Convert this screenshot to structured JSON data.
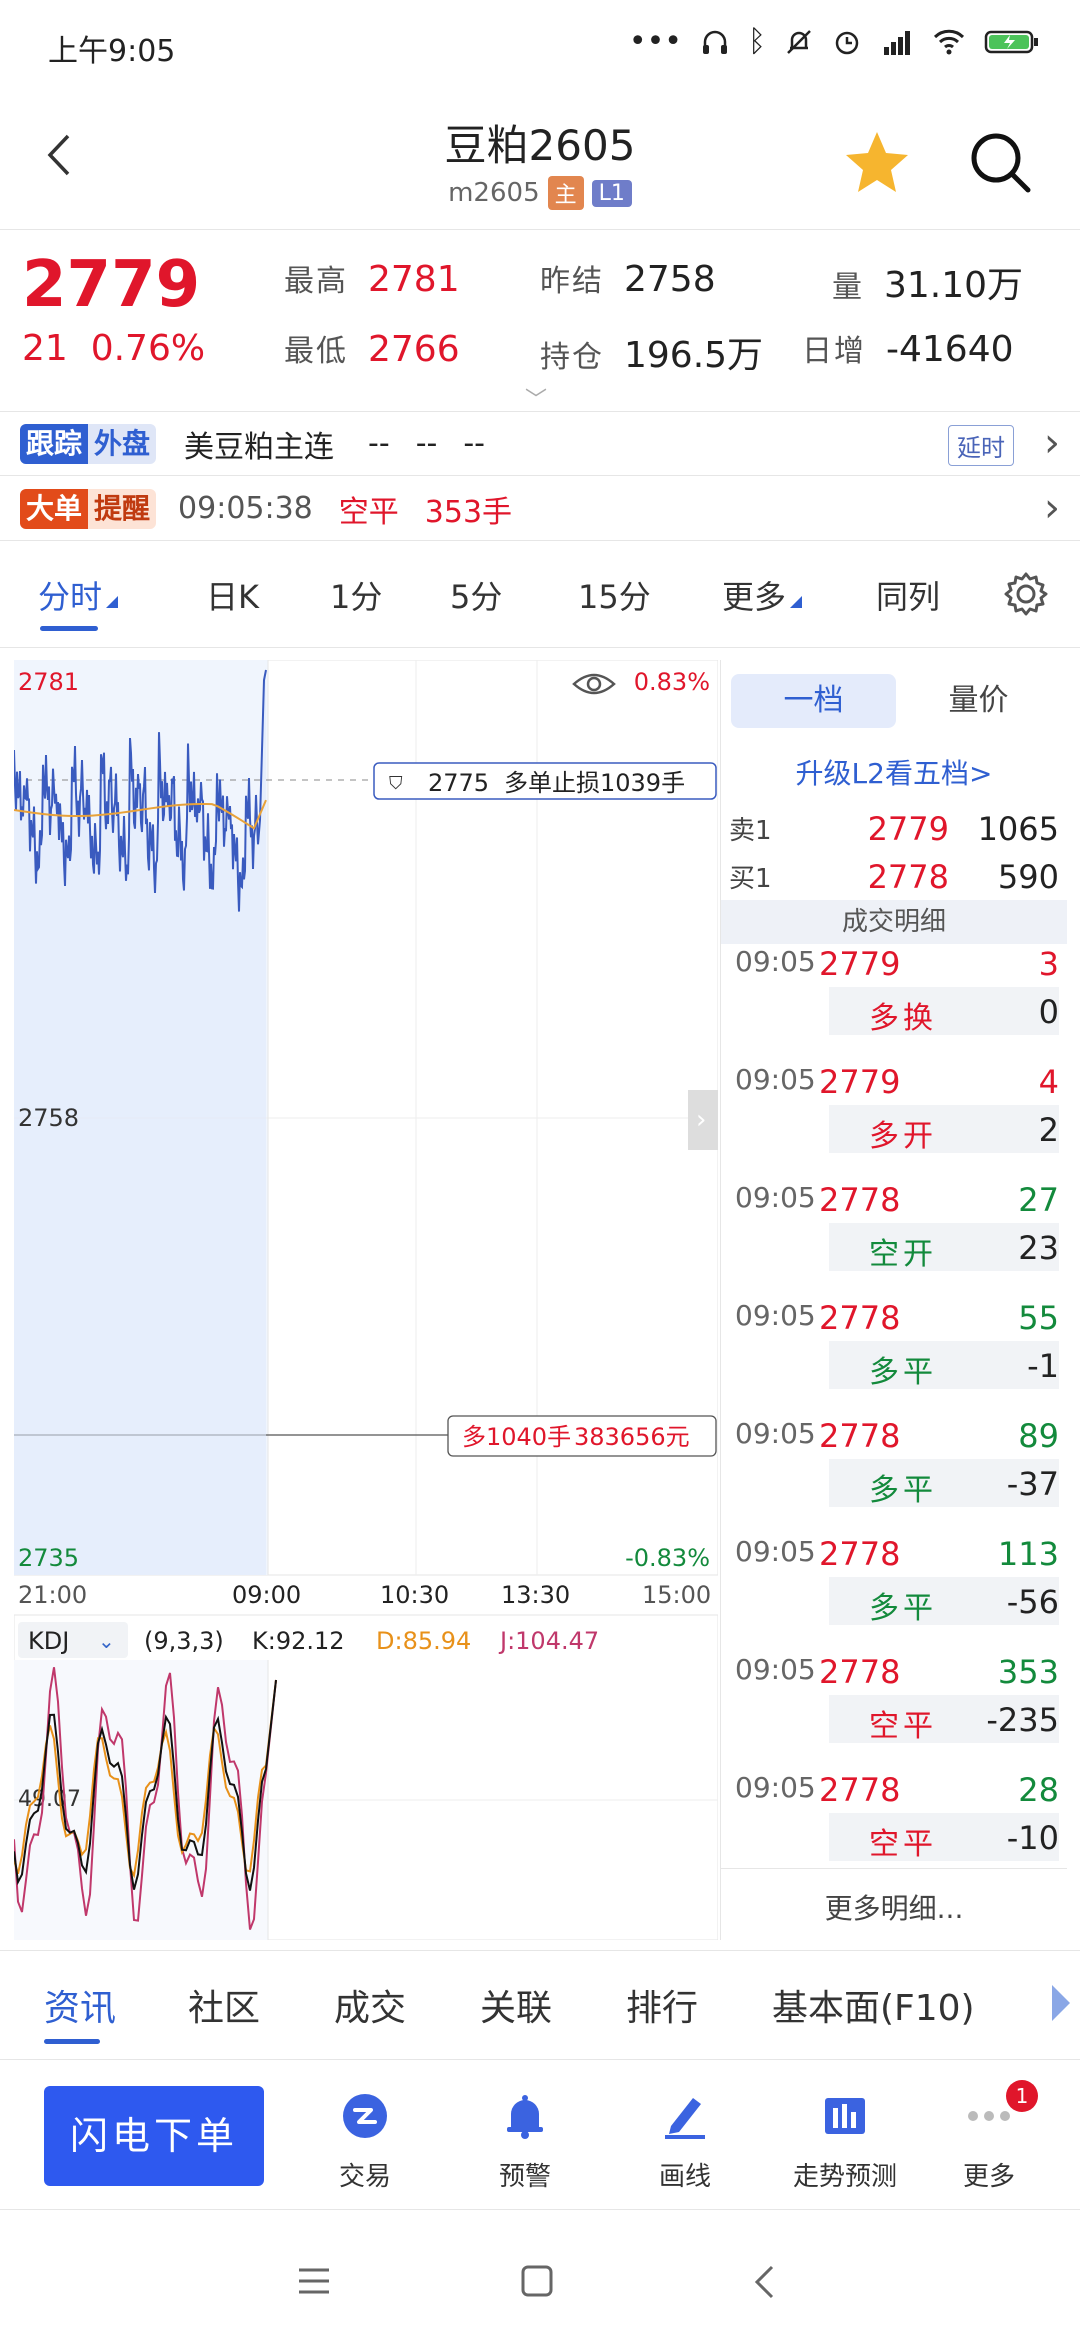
{
  "status_bar": {
    "time": "上午9:05",
    "icons": [
      "more-icon",
      "headphones-icon",
      "bluetooth-icon",
      "mute-icon",
      "alarm-icon",
      "signal-icon",
      "wifi-icon",
      "battery-icon"
    ]
  },
  "header": {
    "title": "豆粕2605",
    "code": "m2605",
    "tag_main": "主",
    "tag_level": "L1"
  },
  "quote": {
    "price": "2779",
    "change": "21",
    "change_pct": "0.76%",
    "high_label": "最高",
    "high": "2781",
    "low_label": "最低",
    "low": "2766",
    "prev_settle_label": "昨结",
    "prev_settle": "2758",
    "open_interest_label": "持仓",
    "open_interest": "196.5万",
    "volume_label": "量",
    "volume": "31.10万",
    "daily_inc_label": "日增",
    "daily_inc": "-41640"
  },
  "track_row": {
    "badge_a": "跟踪",
    "badge_b": "外盘",
    "name": "美豆粕主连",
    "v1": "--",
    "v2": "--",
    "v3": "--",
    "delay": "延时"
  },
  "alert_row": {
    "badge_a": "大单",
    "badge_b": "提醒",
    "time": "09:05:38",
    "type": "空平",
    "qty": "353手"
  },
  "tabs": [
    "分时",
    "日K",
    "1分",
    "5分",
    "15分",
    "更多",
    "同列"
  ],
  "chart": {
    "y_top": "2781",
    "y_mid": "2758",
    "y_bottom": "2735",
    "pct_top": "0.83%",
    "pct_bottom": "-0.83%",
    "x_labels": [
      "21:00",
      "09:00",
      "10:30",
      "13:30",
      "15:00"
    ],
    "stop_loss_price": "2775",
    "stop_loss_text": "多单止损1039手",
    "position_text": "多1040手",
    "position_value": "383656元",
    "indicator": "KDJ",
    "kdj_params": "(9,3,3)",
    "k": "K:92.12",
    "d": "D:85.94",
    "j": "J:104.47",
    "kdj_ref": "49.07"
  },
  "orderbook": {
    "tab_1": "一档",
    "tab_2": "量价",
    "upgrade": "升级L2看五档>",
    "ask_label": "卖1",
    "ask_price": "2779",
    "ask_vol": "1065",
    "bid_label": "买1",
    "bid_price": "2778",
    "bid_vol": "590",
    "detail_header": "成交明细",
    "ticks": [
      {
        "time": "09:05",
        "price": "2779",
        "vol": "3",
        "kind": "多换",
        "oi": "0"
      },
      {
        "time": "09:05",
        "price": "2779",
        "vol": "4",
        "kind": "多开",
        "oi": "2"
      },
      {
        "time": "09:05",
        "price": "2778",
        "vol": "27",
        "kind": "空开",
        "oi": "23"
      },
      {
        "time": "09:05",
        "price": "2778",
        "vol": "55",
        "kind": "多平",
        "oi": "-1"
      },
      {
        "time": "09:05",
        "price": "2778",
        "vol": "89",
        "kind": "多平",
        "oi": "-37"
      },
      {
        "time": "09:05",
        "price": "2778",
        "vol": "113",
        "kind": "多平",
        "oi": "-56"
      },
      {
        "time": "09:05",
        "price": "2778",
        "vol": "353",
        "kind": "空平",
        "oi": "-235"
      },
      {
        "time": "09:05",
        "price": "2778",
        "vol": "28",
        "kind": "空平",
        "oi": "-10"
      }
    ],
    "more": "更多明细..."
  },
  "bottom_tabs": [
    "资讯",
    "社区",
    "成交",
    "关联",
    "排行",
    "基本面(F10)"
  ],
  "actions": {
    "flash": "闪电下单",
    "trade": "交易",
    "alert": "预警",
    "draw": "画线",
    "trend": "走势预测",
    "more": "更多",
    "badge": "1"
  },
  "colors": {
    "up": "#e0162b",
    "down": "#138a3c",
    "accent": "#2f5fd1",
    "price_line": "#3a5bbf",
    "avg_line": "#e8a23a"
  }
}
